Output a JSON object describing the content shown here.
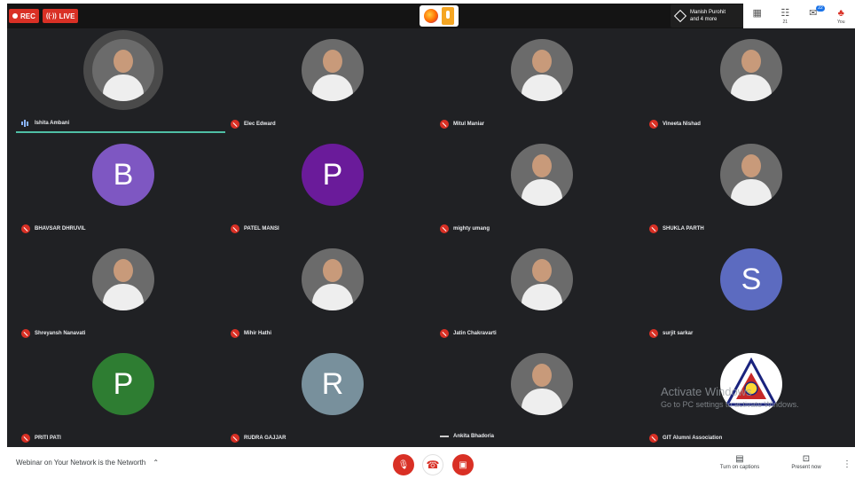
{
  "topbar": {
    "rec_label": "REC",
    "live_label": "LIVE",
    "presenter_line1": "Manish Purohit",
    "presenter_line2": "and 4 more",
    "right_icons": [
      "info-icon",
      "people-icon",
      "chat-icon",
      "activities-icon"
    ],
    "people_count": "21",
    "chat_badge": "22",
    "activities_label": "You"
  },
  "participants": [
    {
      "name": "Ishita Ambani",
      "avatar": "photo",
      "muted": false,
      "speaking": true
    },
    {
      "name": "Elec Edward",
      "avatar": "photo",
      "muted": true
    },
    {
      "name": "Mitul Maniar",
      "avatar": "photo",
      "muted": true
    },
    {
      "name": "Vineeta Nishad",
      "avatar": "photo",
      "muted": true
    },
    {
      "name": "BHAVSAR DHRUVIL",
      "avatar": "B",
      "color": "#7e57c2",
      "muted": true
    },
    {
      "name": "PATEL MANSI",
      "avatar": "P",
      "color": "#6a1b9a",
      "muted": true
    },
    {
      "name": "mighty umang",
      "avatar": "photo",
      "muted": true
    },
    {
      "name": "SHUKLA PARTH",
      "avatar": "photo",
      "muted": true
    },
    {
      "name": "Shreyansh Nanavati",
      "avatar": "photo",
      "muted": true
    },
    {
      "name": "Mihir Hathi",
      "avatar": "photo",
      "muted": true
    },
    {
      "name": "Jatin Chakravarti",
      "avatar": "photo",
      "muted": true
    },
    {
      "name": "surjit sarkar",
      "avatar": "S",
      "color": "#5c6bc0",
      "muted": true
    },
    {
      "name": "PRITI PATI",
      "avatar": "P",
      "color": "#2e7d32",
      "muted": true
    },
    {
      "name": "RUDRA GAJJAR",
      "avatar": "R",
      "color": "#78909c",
      "muted": true
    },
    {
      "name": "Ankita Bhadoria",
      "avatar": "photo",
      "muted": false,
      "speaking": false
    },
    {
      "name": "GIT Alumni Association",
      "avatar": "logo",
      "muted": true
    }
  ],
  "watermark": {
    "line1": "Activate Windows",
    "line2": "Go to PC settings to activate Windows."
  },
  "bottombar": {
    "meeting_title": "Webinar on Your Network is the Networth",
    "captions_label": "Turn on captions",
    "present_label": "Present now"
  }
}
